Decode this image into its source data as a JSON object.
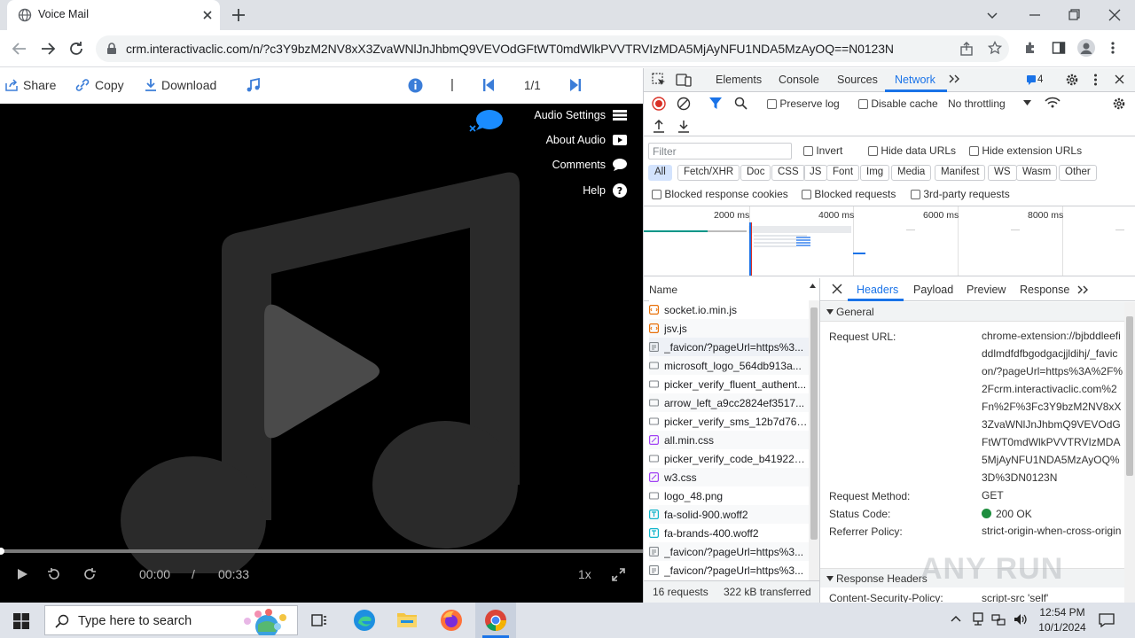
{
  "browser": {
    "tab_title": "Voice Mail",
    "url": "crm.interactivaclic.com/n/?c3Y9bzM2NV8xX3ZvaWNlJnJhbmQ9VEVOdGFtWT0mdWlkPVVTRVIzMDA5MjAyNFU1NDA5MzAyOQ==N0123N"
  },
  "player": {
    "toolbar": {
      "share": "Share",
      "copy": "Copy",
      "download": "Download",
      "separator": "|",
      "page": "1/1"
    },
    "menu": {
      "audio_settings": "Audio Settings",
      "about_audio": "About Audio",
      "comments": "Comments",
      "help": "Help"
    },
    "time_current": "00:00",
    "time_sep": "/",
    "time_total": "00:33",
    "speed": "1x",
    "progress_fraction": 0
  },
  "devtools": {
    "tabs": [
      "Elements",
      "Console",
      "Sources",
      "Network"
    ],
    "issues_count": "4",
    "preserve_log": "Preserve log",
    "disable_cache": "Disable cache",
    "throttling": "No throttling",
    "filter_placeholder": "Filter",
    "invert": "Invert",
    "hide_data_urls": "Hide data URLs",
    "hide_ext_urls": "Hide extension URLs",
    "type_filters": [
      "All",
      "Fetch/XHR",
      "Doc",
      "CSS",
      "JS",
      "Font",
      "Img",
      "Media",
      "Manifest",
      "WS",
      "Wasm",
      "Other"
    ],
    "blocked_cookies": "Blocked response cookies",
    "blocked_requests": "Blocked requests",
    "third_party": "3rd-party requests",
    "timeline_ticks": [
      "2000 ms",
      "4000 ms",
      "6000 ms",
      "8000 ms"
    ],
    "name_header": "Name",
    "requests": [
      {
        "name": "socket.io.min.js",
        "kind": "js"
      },
      {
        "name": "jsv.js",
        "kind": "js"
      },
      {
        "name": "_favicon/?pageUrl=https%3...",
        "kind": "doc"
      },
      {
        "name": "microsoft_logo_564db913a...",
        "kind": "img"
      },
      {
        "name": "picker_verify_fluent_authent...",
        "kind": "img"
      },
      {
        "name": "arrow_left_a9cc2824ef3517...",
        "kind": "img"
      },
      {
        "name": "picker_verify_sms_12b7d768...",
        "kind": "img"
      },
      {
        "name": "all.min.css",
        "kind": "css"
      },
      {
        "name": "picker_verify_code_b41922e...",
        "kind": "img"
      },
      {
        "name": "w3.css",
        "kind": "css"
      },
      {
        "name": "logo_48.png",
        "kind": "img"
      },
      {
        "name": "fa-solid-900.woff2",
        "kind": "font"
      },
      {
        "name": "fa-brands-400.woff2",
        "kind": "font"
      },
      {
        "name": "_favicon/?pageUrl=https%3...",
        "kind": "doc"
      },
      {
        "name": "_favicon/?pageUrl=https%3...",
        "kind": "doc"
      }
    ],
    "summary_requests": "16 requests",
    "summary_transfer": "322 kB transferred",
    "detail_tabs": [
      "Headers",
      "Payload",
      "Preview",
      "Response"
    ],
    "general_label": "General",
    "request_url_label": "Request URL:",
    "request_url": "chrome-extension://bjbddleefiddlmdfdfbgodgacjjldihj/_favicon/?pageUrl=https%3A%2F%2Fcrm.interactivaclic.com%2Fn%2F%3Fc3Y9bzM2NV8xX3ZvaWNlJnJhbmQ9VEVOdGFtWT0mdWlkPVVTRVIzMDA5MjAyNFU1NDA5MzAyOQ%3D%3DN0123N",
    "method_label": "Request Method:",
    "method": "GET",
    "status_label": "Status Code:",
    "status": "200 OK",
    "referrer_label": "Referrer Policy:",
    "referrer": "strict-origin-when-cross-origin",
    "response_headers_label": "Response Headers",
    "csp_label": "Content-Security-Policy:",
    "csp": "script-src 'self'"
  },
  "taskbar": {
    "search_placeholder": "Type here to search",
    "time": "12:54 PM",
    "date": "10/1/2024"
  },
  "watermark": "ANY RUN",
  "colors": {
    "accent": "#1a73e8",
    "network_blue": "#1a73e8",
    "record_red": "#d93025",
    "status_green": "#1e8e3e",
    "chat_blue": "#1a8cff"
  }
}
